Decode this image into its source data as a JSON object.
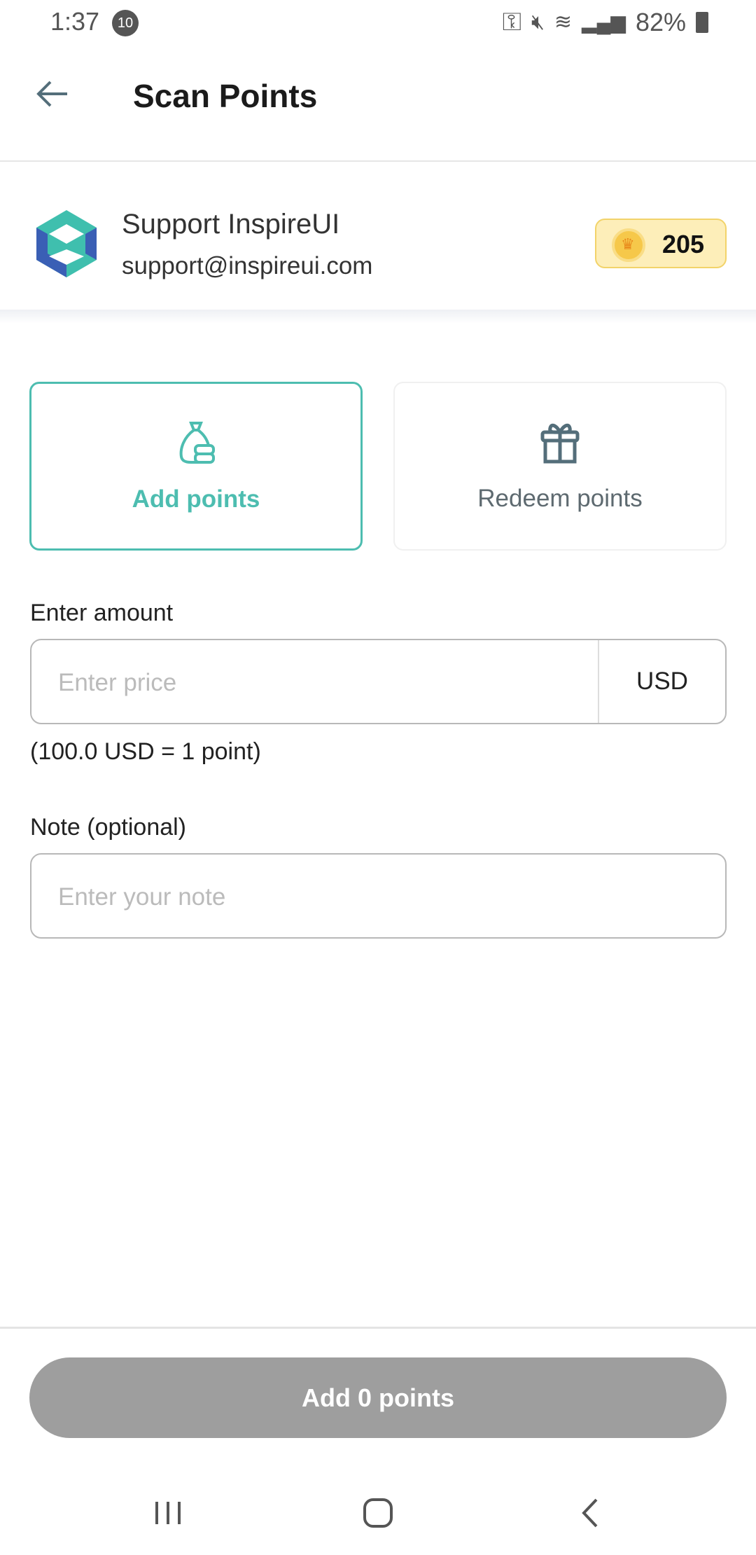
{
  "status_bar": {
    "time": "1:37",
    "notification_count": "10",
    "battery": "82%"
  },
  "header": {
    "title": "Scan Points"
  },
  "profile": {
    "name": "Support InspireUI",
    "email": "support@inspireui.com",
    "points": "205"
  },
  "modes": [
    {
      "label": "Add points",
      "icon": "money-bag-icon",
      "active": true
    },
    {
      "label": "Redeem points",
      "icon": "gift-icon",
      "active": false
    }
  ],
  "amount": {
    "label": "Enter amount",
    "placeholder": "Enter price",
    "currency": "USD",
    "rate_hint": "(100.0 USD = 1 point)"
  },
  "note": {
    "label": "Note (optional)",
    "placeholder": "Enter your note"
  },
  "submit": {
    "label": "Add 0 points"
  },
  "colors": {
    "accent": "#4dbdb0",
    "disabled_button": "#9e9e9e",
    "badge": "#fdeeb9"
  }
}
